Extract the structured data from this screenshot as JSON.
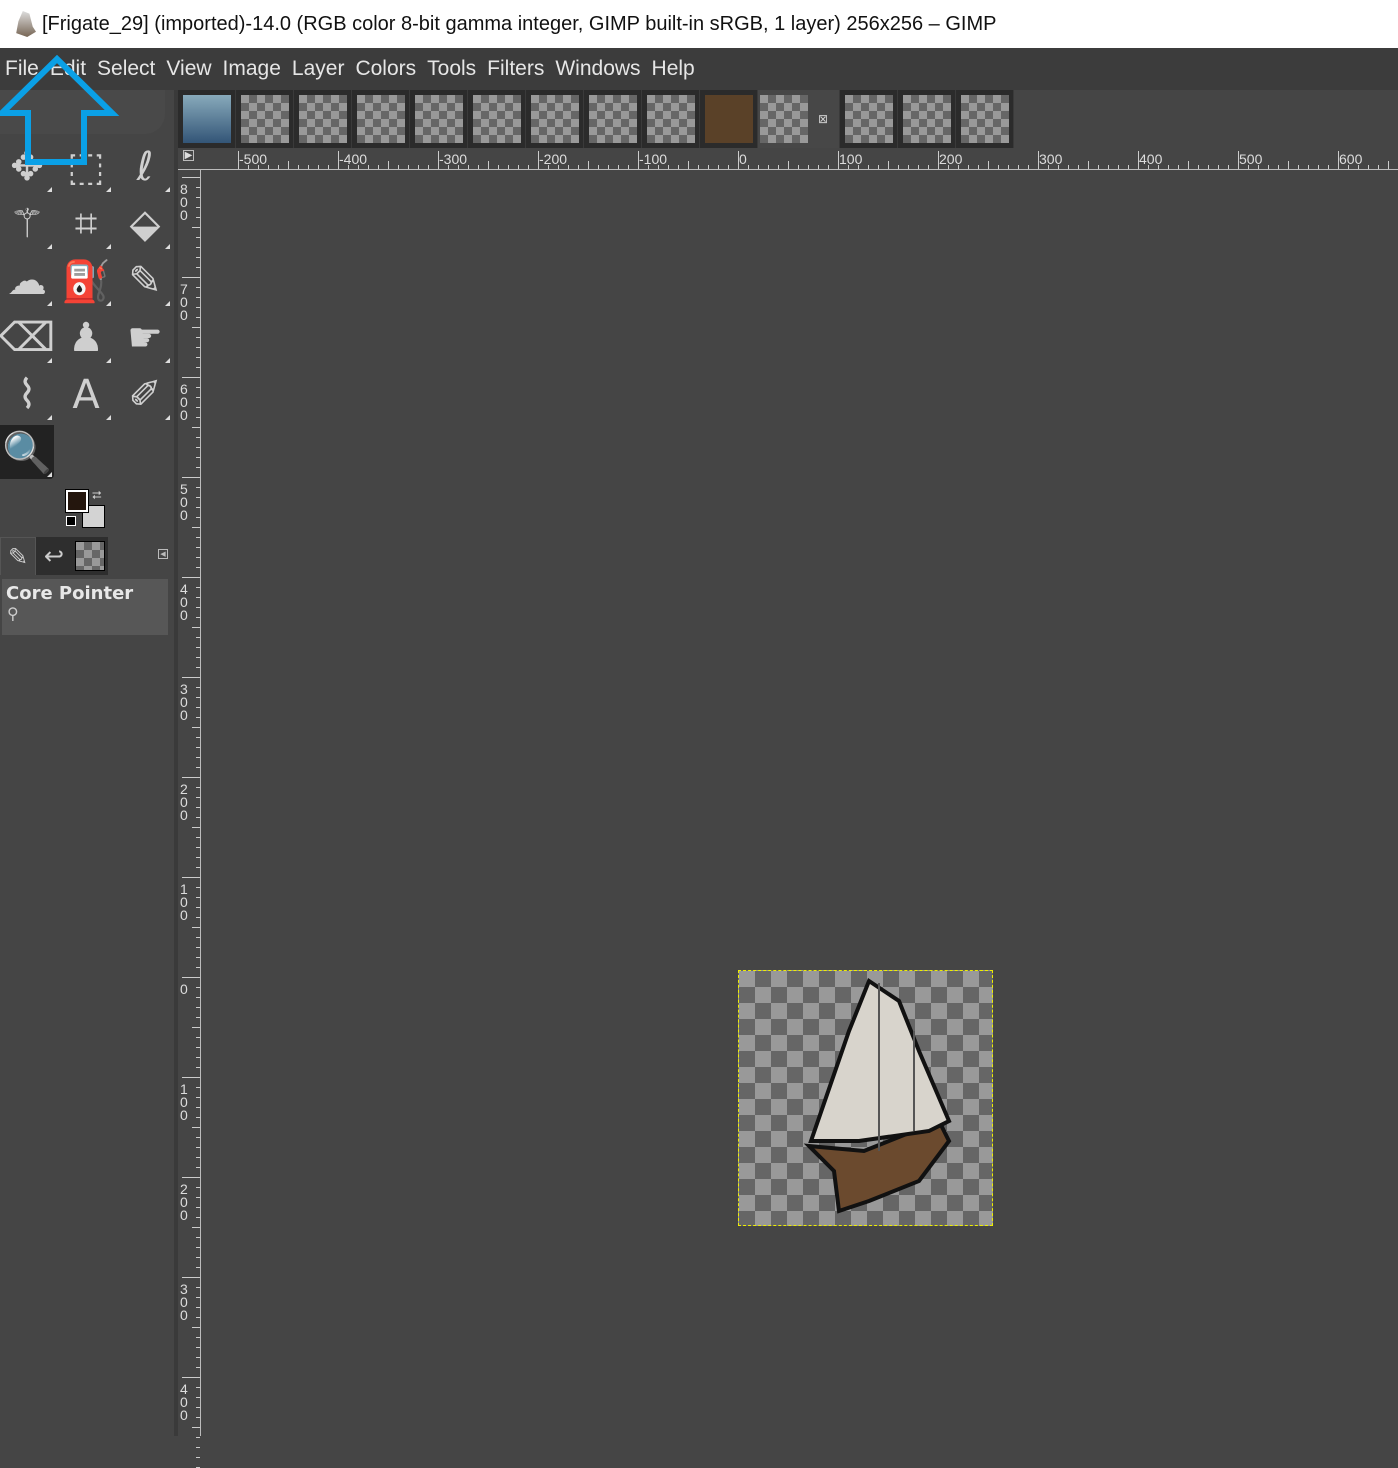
{
  "window": {
    "title": "[Frigate_29] (imported)-14.0 (RGB color 8-bit gamma integer, GIMP built-in sRGB, 1 layer) 256x256 – GIMP"
  },
  "menu": [
    "File",
    "Edit",
    "Select",
    "View",
    "Image",
    "Layer",
    "Colors",
    "Tools",
    "Filters",
    "Windows",
    "Help"
  ],
  "tools": [
    {
      "name": "move-tool",
      "glyph": "✥"
    },
    {
      "name": "rect-select-tool",
      "glyph": "⬚"
    },
    {
      "name": "free-select-tool",
      "glyph": "ℓ"
    },
    {
      "name": "fuzzy-select-tool",
      "glyph": "⚚"
    },
    {
      "name": "crop-tool",
      "glyph": "⌗"
    },
    {
      "name": "transform-tool",
      "glyph": "⬙"
    },
    {
      "name": "warp-tool",
      "glyph": "☁"
    },
    {
      "name": "bucket-fill-tool",
      "glyph": "⛽"
    },
    {
      "name": "pencil-tool",
      "glyph": "✎"
    },
    {
      "name": "eraser-tool",
      "glyph": "⌫"
    },
    {
      "name": "clone-tool",
      "glyph": "♟"
    },
    {
      "name": "smudge-tool",
      "glyph": "☛"
    },
    {
      "name": "paths-tool",
      "glyph": "⌇"
    },
    {
      "name": "text-tool",
      "glyph": "A"
    },
    {
      "name": "color-picker-tool",
      "glyph": "✐"
    },
    {
      "name": "zoom-tool",
      "glyph": "🔍"
    }
  ],
  "colors": {
    "foreground": "#24160d",
    "background": "#d3d3d3",
    "arrow": "#0aa0e6"
  },
  "device": {
    "name": "Core Pointer"
  },
  "image_tabs": {
    "count": 14,
    "active": 10
  },
  "rulers": {
    "horizontal": [
      "-500",
      "-400",
      "-300",
      "-200",
      "-100",
      "0",
      "100",
      "200",
      "300",
      "400",
      "500",
      "600"
    ],
    "vertical": [
      "800",
      "700",
      "600",
      "500",
      "400",
      "300",
      "200",
      "100",
      "0",
      "100",
      "200",
      "300",
      "400"
    ]
  }
}
